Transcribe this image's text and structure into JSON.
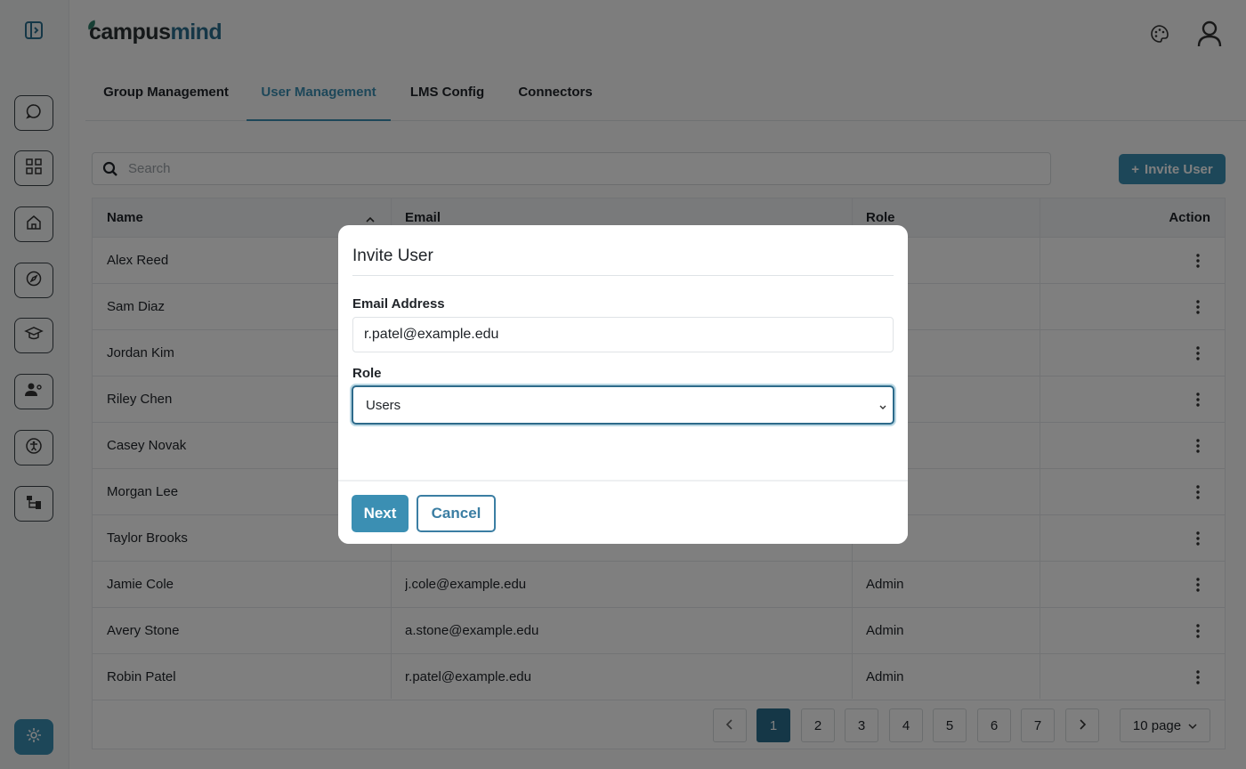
{
  "app": {
    "logo_prefix": "campus",
    "logo_suffix": "mind"
  },
  "sidebar": {
    "icons": [
      "panel-toggle-icon",
      "chat-icon",
      "grid-icon",
      "home-icon",
      "compass-icon",
      "graduation-cap-icon",
      "user-settings-icon",
      "accessibility-icon",
      "hierarchy-icon",
      "settings-icon"
    ]
  },
  "header": {
    "icons": [
      "palette-icon",
      "user-icon"
    ]
  },
  "tabs": [
    {
      "label": "Group Management",
      "active": false
    },
    {
      "label": "User Management",
      "active": true
    },
    {
      "label": "LMS Config",
      "active": false
    },
    {
      "label": "Connectors",
      "active": false
    }
  ],
  "search": {
    "placeholder": "Search",
    "value": ""
  },
  "invite_button": {
    "label": "Invite User"
  },
  "table": {
    "columns": [
      "Name",
      "Email",
      "Role",
      "Action"
    ],
    "rows": [
      {
        "name": "Alex Reed",
        "email": "",
        "role": ""
      },
      {
        "name": "Sam Diaz",
        "email": "",
        "role": ""
      },
      {
        "name": "Jordan Kim",
        "email": "",
        "role": ""
      },
      {
        "name": "Riley Chen",
        "email": "",
        "role": ""
      },
      {
        "name": "Casey Novak",
        "email": "",
        "role": ""
      },
      {
        "name": "Morgan Lee",
        "email": "",
        "role": ""
      },
      {
        "name": "Taylor Brooks",
        "email": "",
        "role": ""
      },
      {
        "name": "Jamie Cole",
        "email": "j.cole@example.edu",
        "role": "Admin"
      },
      {
        "name": "Avery Stone",
        "email": "a.stone@example.edu",
        "role": "Admin"
      },
      {
        "name": "Robin Patel",
        "email": "r.patel@example.edu",
        "role": "Admin"
      }
    ]
  },
  "pagination": {
    "pages": [
      "1",
      "2",
      "3",
      "4",
      "5",
      "6",
      "7"
    ],
    "current": "1",
    "per_page": "10 page"
  },
  "modal": {
    "title": "Invite User",
    "email_label": "Email Address",
    "email_value": "r.patel@example.edu",
    "role_label": "Role",
    "role_value": "Users",
    "next_label": "Next",
    "cancel_label": "Cancel"
  },
  "colors": {
    "accent": "#3b8fb3",
    "accent_dark": "#2a6f8e"
  }
}
